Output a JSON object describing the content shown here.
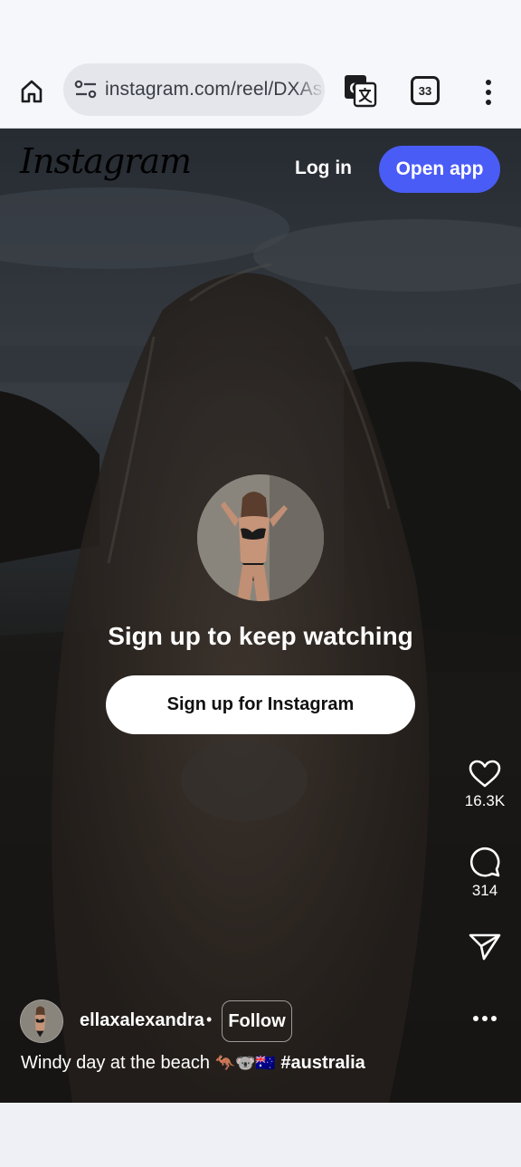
{
  "browser": {
    "url": "instagram.com/reel/DXAs",
    "tab_count": "33"
  },
  "header": {
    "logo_text": "Instagram",
    "login_label": "Log in",
    "open_app_label": "Open app"
  },
  "prompt": {
    "title": "Sign up to keep watching",
    "signup_button_label": "Sign up for Instagram"
  },
  "actions": {
    "like_count": "16.3K",
    "comment_count": "314"
  },
  "post": {
    "username": "ellaxalexandra",
    "separator": "•",
    "follow_label": "Follow",
    "caption_text": "Windy day at the beach",
    "caption_emojis": "🦘🐨🇦🇺",
    "caption_hashtag": "#australia"
  },
  "colors": {
    "accent": "#4a5cf6",
    "reel_bg": "#1e1c1b"
  }
}
